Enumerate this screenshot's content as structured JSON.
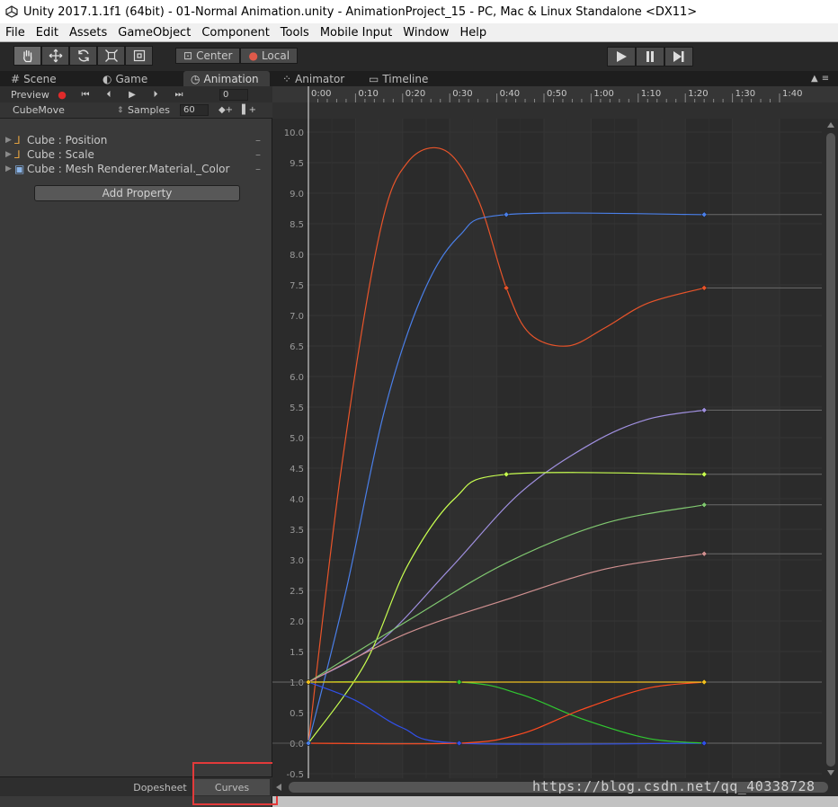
{
  "window_title": "Unity 2017.1.1f1 (64bit) - 01-Normal Animation.unity - AnimationProject_15 - PC, Mac & Linux Standalone <DX11>",
  "menu": [
    "File",
    "Edit",
    "Assets",
    "GameObject",
    "Component",
    "Tools",
    "Mobile Input",
    "Window",
    "Help"
  ],
  "toolbar": {
    "tools": [
      "hand-icon",
      "move-icon",
      "rotate-icon",
      "scale-icon",
      "rect-tool-icon"
    ],
    "pivot_center": "Center",
    "pivot_local": "Local",
    "play_controls": [
      "play-icon",
      "pause-icon",
      "step-icon"
    ]
  },
  "tabs": [
    {
      "label": "Scene",
      "icon": "scene-icon"
    },
    {
      "label": "Game",
      "icon": "game-icon"
    },
    {
      "label": "Animation",
      "icon": "clock-icon",
      "active": true
    },
    {
      "label": "Animator",
      "icon": "animator-icon"
    },
    {
      "label": "Timeline",
      "icon": "timeline-icon"
    }
  ],
  "animation": {
    "preview_label": "Preview",
    "frame": "0",
    "clip": "CubeMove",
    "samples_label": "Samples",
    "samples": "60",
    "properties": [
      "Cube : Position",
      "Cube : Scale",
      "Cube : Mesh Renderer.Material._Color"
    ],
    "add_property": "Add Property",
    "bottom_tabs": [
      "Dopesheet",
      "Curves"
    ],
    "active_bottom_tab": "Curves"
  },
  "watermark": "https://blog.csdn.net/qq_40338728",
  "chart_data": {
    "type": "line",
    "x_ticks": [
      "0:00",
      "0:10",
      "0:20",
      "0:30",
      "0:40",
      "0:50",
      "1:00",
      "1:10",
      "1:20",
      "1:30",
      "1:40"
    ],
    "y_ticks": [
      "10.0",
      "9.5",
      "9.0",
      "8.5",
      "8.0",
      "7.5",
      "7.0",
      "6.5",
      "6.0",
      "5.5",
      "5.0",
      "4.5",
      "4.0",
      "3.5",
      "3.0",
      "2.5",
      "2.0",
      "1.5",
      "1.0",
      "0.5",
      "0.0",
      "-0.5"
    ],
    "ylim": [
      -0.5,
      10.0
    ],
    "xunit": "seconds",
    "series": [
      {
        "color": "#e8542a",
        "points": [
          [
            0,
            0.0
          ],
          [
            7,
            4.5
          ],
          [
            15,
            8.3
          ],
          [
            21,
            9.5
          ],
          [
            29,
            9.7
          ],
          [
            36,
            8.9
          ],
          [
            42,
            7.45
          ],
          [
            47,
            6.7
          ],
          [
            55,
            6.5
          ],
          [
            63,
            6.8
          ],
          [
            72,
            7.2
          ],
          [
            84,
            7.45
          ]
        ]
      },
      {
        "color": "#4a7fe8",
        "points": [
          [
            0,
            0.0
          ],
          [
            8,
            2.5
          ],
          [
            16,
            5.4
          ],
          [
            24,
            7.3
          ],
          [
            32,
            8.3
          ],
          [
            42,
            8.65
          ],
          [
            84,
            8.65
          ]
        ]
      },
      {
        "color": "#a090e0",
        "points": [
          [
            0,
            1.0
          ],
          [
            15,
            1.65
          ],
          [
            30,
            2.85
          ],
          [
            45,
            4.1
          ],
          [
            60,
            4.9
          ],
          [
            72,
            5.3
          ],
          [
            84,
            5.45
          ]
        ]
      },
      {
        "color": "#c8ff50",
        "points": [
          [
            0,
            0.0
          ],
          [
            12,
            1.3
          ],
          [
            21,
            2.9
          ],
          [
            31,
            4.0
          ],
          [
            42,
            4.4
          ],
          [
            84,
            4.4
          ]
        ]
      },
      {
        "color": "#80c870",
        "points": [
          [
            0,
            1.0
          ],
          [
            21,
            2.0
          ],
          [
            42,
            2.95
          ],
          [
            63,
            3.6
          ],
          [
            84,
            3.9
          ]
        ]
      },
      {
        "color": "#d09090",
        "points": [
          [
            0,
            1.0
          ],
          [
            21,
            1.8
          ],
          [
            42,
            2.35
          ],
          [
            63,
            2.85
          ],
          [
            84,
            3.1
          ]
        ]
      },
      {
        "color": "#3050e8",
        "points": [
          [
            0,
            1.0
          ],
          [
            10,
            0.7
          ],
          [
            20,
            0.25
          ],
          [
            32,
            0.0
          ],
          [
            84,
            0.0
          ]
        ]
      },
      {
        "color": "#30c830",
        "points": [
          [
            0,
            1.0
          ],
          [
            32,
            1.0
          ],
          [
            45,
            0.8
          ],
          [
            58,
            0.4
          ],
          [
            72,
            0.08
          ],
          [
            84,
            0.0
          ]
        ]
      },
      {
        "color": "#ff4a20",
        "points": [
          [
            0,
            0.0
          ],
          [
            32,
            0.0
          ],
          [
            45,
            0.15
          ],
          [
            58,
            0.55
          ],
          [
            72,
            0.9
          ],
          [
            84,
            1.0
          ]
        ]
      },
      {
        "color": "#f0c020",
        "points": [
          [
            0,
            1.0
          ],
          [
            84,
            1.0
          ]
        ]
      }
    ],
    "keyframes": [
      {
        "x": 0,
        "y": 0.0,
        "color": "#4a7fe8"
      },
      {
        "x": 0,
        "y": 1.0,
        "color": "#f0c020"
      },
      {
        "x": 32,
        "y": 1.0,
        "color": "#30c830"
      },
      {
        "x": 32,
        "y": 0.0,
        "color": "#3050e8"
      },
      {
        "x": 42,
        "y": 8.65,
        "color": "#4a7fe8"
      },
      {
        "x": 42,
        "y": 7.45,
        "color": "#e8542a"
      },
      {
        "x": 42,
        "y": 4.4,
        "color": "#c8ff50"
      },
      {
        "x": 84,
        "y": 8.65,
        "color": "#4a7fe8"
      },
      {
        "x": 84,
        "y": 7.45,
        "color": "#e8542a"
      },
      {
        "x": 84,
        "y": 5.45,
        "color": "#a090e0"
      },
      {
        "x": 84,
        "y": 4.4,
        "color": "#c8ff50"
      },
      {
        "x": 84,
        "y": 3.9,
        "color": "#80c870"
      },
      {
        "x": 84,
        "y": 3.1,
        "color": "#d09090"
      },
      {
        "x": 84,
        "y": 1.0,
        "color": "#f0c020"
      },
      {
        "x": 84,
        "y": 0.0,
        "color": "#3050e8"
      }
    ]
  }
}
